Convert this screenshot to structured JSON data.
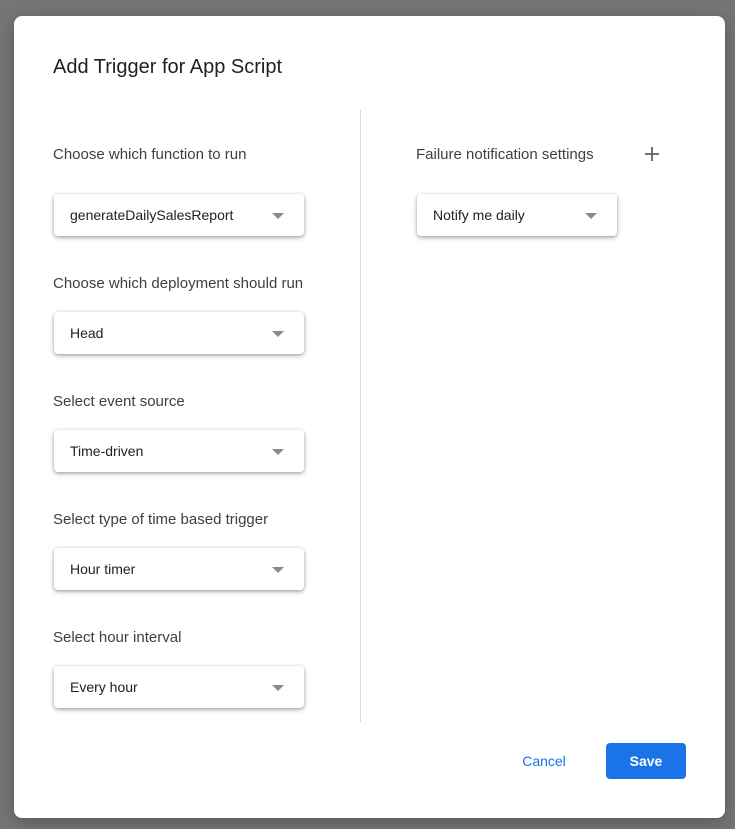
{
  "dialog": {
    "title": "Add Trigger for App Script"
  },
  "left": {
    "function": {
      "label": "Choose which function to run",
      "value": "generateDailySalesReport"
    },
    "deployment": {
      "label": "Choose which deployment should run",
      "value": "Head"
    },
    "event_source": {
      "label": "Select event source",
      "value": "Time-driven"
    },
    "trigger_type": {
      "label": "Select type of time based trigger",
      "value": "Hour timer"
    },
    "hour_interval": {
      "label": "Select hour interval",
      "value": "Every hour"
    }
  },
  "right": {
    "failure": {
      "label": "Failure notification settings",
      "value": "Notify me daily",
      "add_icon": "plus-icon"
    }
  },
  "footer": {
    "cancel_label": "Cancel",
    "save_label": "Save"
  },
  "colors": {
    "accent": "#1a73e8",
    "backdrop": "#757575"
  }
}
